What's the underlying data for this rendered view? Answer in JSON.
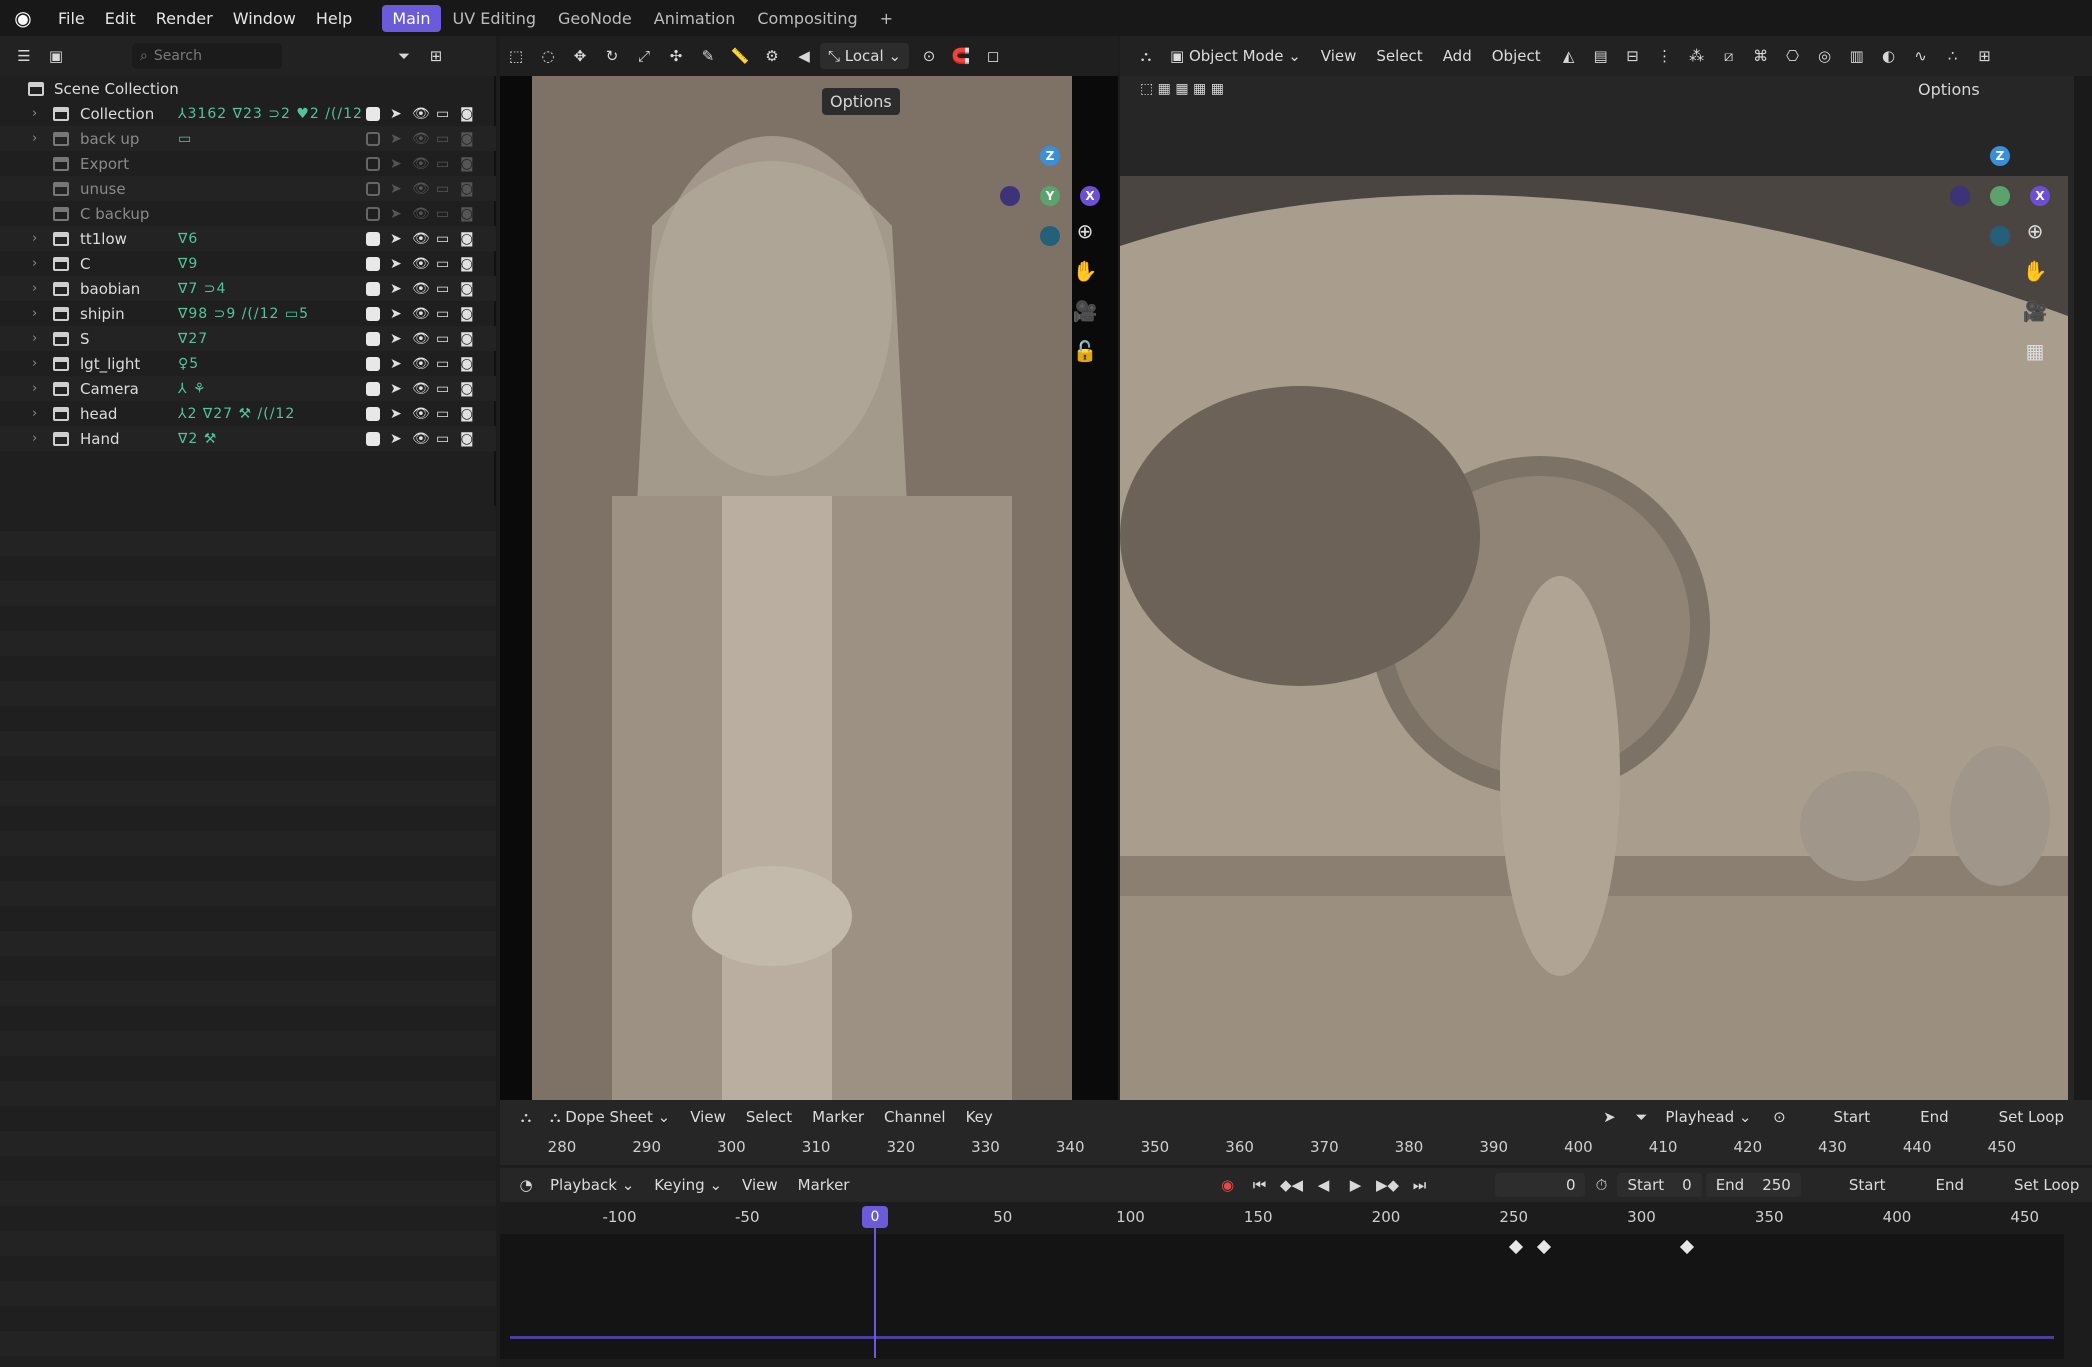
{
  "topbar": {
    "menus": [
      "File",
      "Edit",
      "Render",
      "Window",
      "Help"
    ],
    "workspaces": [
      "Main",
      "UV Editing",
      "GeoNode",
      "Animation",
      "Compositing"
    ],
    "active_workspace": "Main",
    "add_tab": "+"
  },
  "outliner": {
    "search_placeholder": "Search",
    "root": "Scene Collection",
    "rows": [
      {
        "name": "Collection",
        "expandable": true,
        "enabled": true,
        "extras": "⅄3162 ∇23 ⊃2 ♥2 /(/12"
      },
      {
        "name": "back up",
        "expandable": true,
        "enabled": false,
        "extras": "▭"
      },
      {
        "name": "Export",
        "expandable": false,
        "enabled": false,
        "extras": ""
      },
      {
        "name": "unuse",
        "expandable": false,
        "enabled": false,
        "extras": ""
      },
      {
        "name": "C backup",
        "expandable": false,
        "enabled": false,
        "extras": ""
      },
      {
        "name": "tt1low",
        "expandable": true,
        "enabled": true,
        "extras": "∇6"
      },
      {
        "name": "C",
        "expandable": true,
        "enabled": true,
        "extras": "∇9"
      },
      {
        "name": "baobian",
        "expandable": true,
        "enabled": true,
        "extras": "∇7 ⊃4"
      },
      {
        "name": "shipin",
        "expandable": true,
        "enabled": true,
        "extras": "∇98 ⊃9 /(/12 ▭5"
      },
      {
        "name": "S",
        "expandable": true,
        "enabled": true,
        "extras": "∇27"
      },
      {
        "name": "lgt_light",
        "expandable": true,
        "enabled": true,
        "extras": "♀5"
      },
      {
        "name": "Camera",
        "expandable": true,
        "enabled": true,
        "extras": "⅄ ⚘"
      },
      {
        "name": "head",
        "expandable": true,
        "enabled": true,
        "extras": "⅄2 ∇27 ⚒ /(/12"
      },
      {
        "name": "Hand",
        "expandable": true,
        "enabled": true,
        "extras": "∇2 ⚒"
      }
    ]
  },
  "viewport_left": {
    "transform_orientation": "Local",
    "options_label": "Options"
  },
  "viewport_right": {
    "mode": "Object Mode",
    "menus": [
      "View",
      "Select",
      "Add",
      "Object"
    ],
    "options_label": "Options"
  },
  "gizmo": {
    "z": "Z",
    "y": "Y",
    "x": "X"
  },
  "dopesheet": {
    "editor": "Dope Sheet",
    "menus": [
      "View",
      "Select",
      "Marker",
      "Channel",
      "Key"
    ],
    "playhead_label": "Playhead",
    "start_label": "Start",
    "end_label": "End",
    "set_loop_label": "Set Loop",
    "ruler": [
      "280",
      "290",
      "300",
      "310",
      "320",
      "330",
      "340",
      "350",
      "360",
      "370",
      "380",
      "390",
      "400",
      "410",
      "420",
      "430",
      "440",
      "450"
    ]
  },
  "timeline": {
    "menus": [
      "Playback",
      "Keying",
      "View",
      "Marker"
    ],
    "current_frame": "0",
    "start_label": "Start",
    "start_value": "0",
    "end_label": "End",
    "end_value": "250",
    "start2_label": "Start",
    "end2_label": "End",
    "set_loop_label": "Set Loop",
    "ruler": [
      "-100",
      "-50",
      "50",
      "100",
      "150",
      "200",
      "250",
      "300",
      "350",
      "400",
      "450"
    ],
    "playhead_value": "0",
    "keyframes": [
      251,
      262,
      318
    ]
  },
  "colors": {
    "accent": "#6b5ad9",
    "green": "#53c49a"
  }
}
